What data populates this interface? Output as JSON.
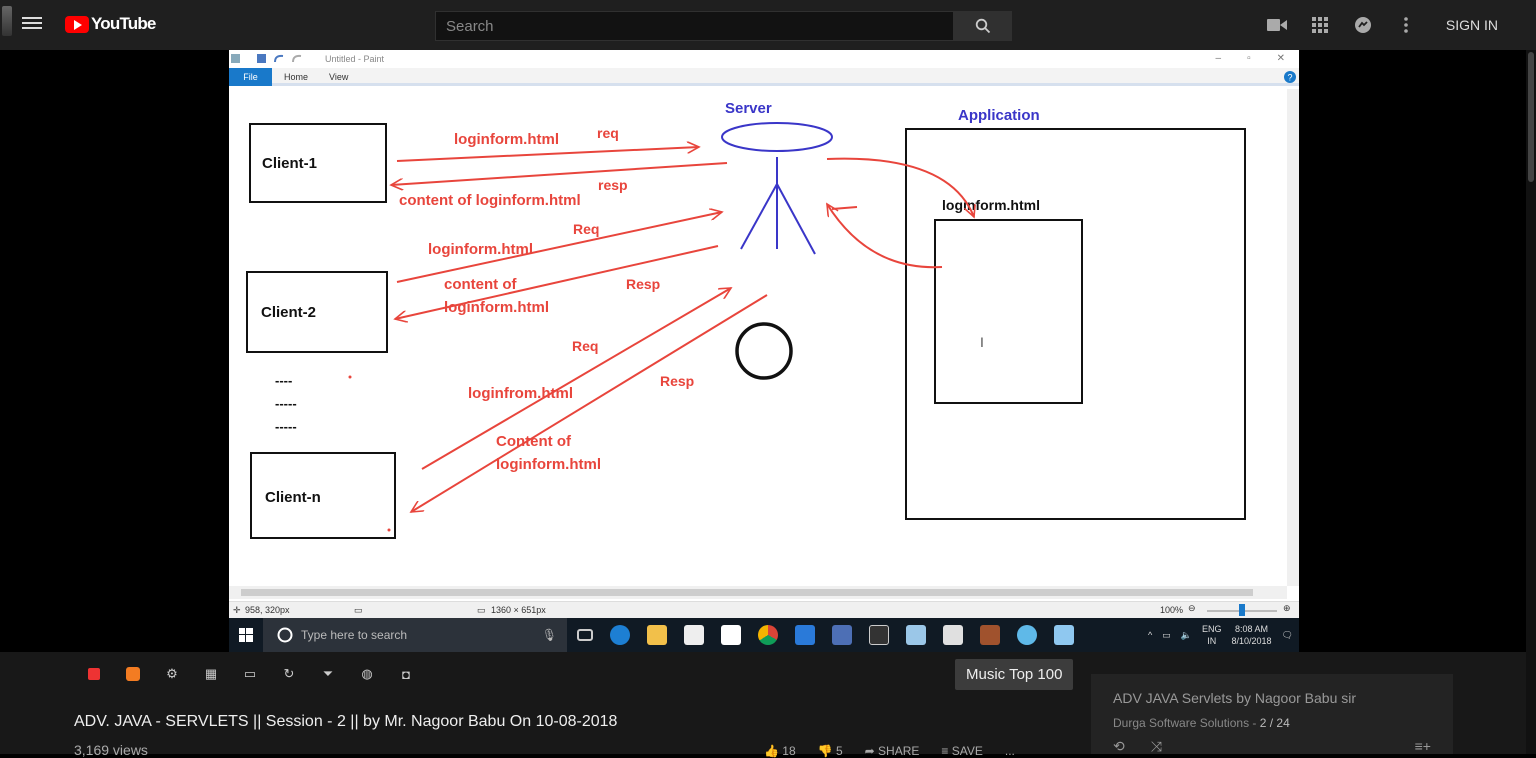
{
  "header": {
    "logo_text": "YouTube",
    "search_placeholder": "Search",
    "sign_in": "SIGN IN"
  },
  "paint": {
    "title": "Untitled - Paint",
    "tabs": [
      "File",
      "Home",
      "View"
    ],
    "status_cursor": "958, 320px",
    "status_size": "1360 × 651px",
    "zoom": "100%"
  },
  "diagram": {
    "server_label": "Server",
    "application_label": "Application",
    "client1": "Client-1",
    "client2": "Client-2",
    "clientn": "Client-n",
    "dashes": [
      "----",
      "-----",
      "-----"
    ],
    "inner_file": "loginform.html",
    "arrow_labels": {
      "a1": "loginform.html",
      "a1_req": "req",
      "a1_resp": "resp",
      "a1_content": "content of loginform.html",
      "a2_req": "Req",
      "a2_file": "loginform.html",
      "a2_content1": "content of",
      "a2_content2": "loginform.html",
      "a2_resp": "Resp",
      "a3_req": "Req",
      "a3_file": "loginfrom.html",
      "a3_resp": "Resp",
      "a3_content1": "Content of",
      "a3_content2": "loginform.html"
    }
  },
  "taskbar": {
    "search_placeholder": "Type here to search",
    "lang1": "ENG",
    "lang2": "IN",
    "time": "8:08 AM",
    "date": "8/10/2018"
  },
  "below": {
    "music_chip": "Music Top 100",
    "video_title": "ADV. JAVA - SERVLETS || Session - 2 || by Mr. Nagoor Babu On 10-08-2018",
    "views": "3,169 views",
    "likes": "18",
    "dislikes": "5",
    "share": "SHARE",
    "save": "SAVE",
    "more": "..."
  },
  "playlist": {
    "title": "ADV JAVA Servlets by Nagoor Babu sir",
    "channel": "Durga Software Solutions",
    "separator": " - ",
    "position": "2 / 24"
  },
  "colors": {
    "accent_red": "#ff0000",
    "diagram_red": "#e8453c",
    "diagram_blue": "#3a36c8"
  }
}
